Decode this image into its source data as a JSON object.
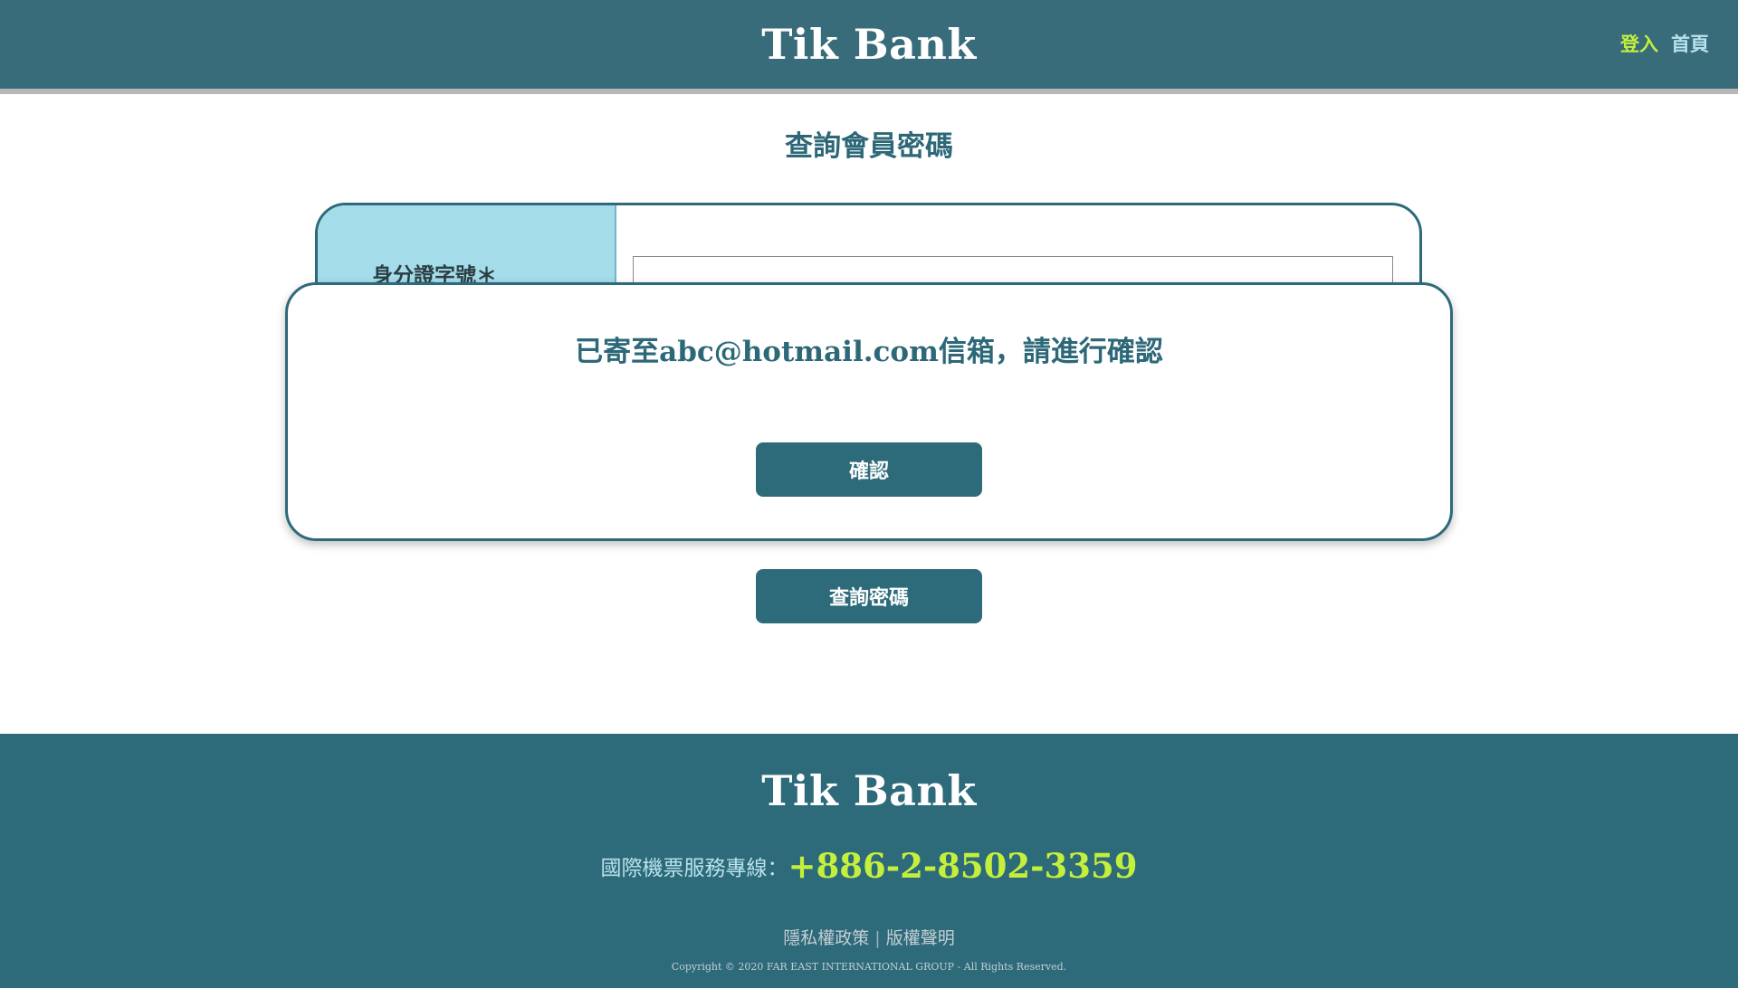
{
  "header": {
    "logo": "Tik Bank",
    "nav": {
      "login": "登入",
      "home": "首頁"
    }
  },
  "main": {
    "title": "查詢會員密碼",
    "form": {
      "id_label": "身分證字號＊",
      "id_value": ""
    },
    "query_button": "查詢密碼"
  },
  "modal": {
    "message": "已寄至abc@hotmail.com信箱，請進行確認",
    "confirm_button": "確認"
  },
  "footer": {
    "logo": "Tik Bank",
    "hotline_label": "國際機票服務專線：",
    "hotline_number": "+886-2-8502-3359",
    "links": {
      "privacy": "隱私權政策",
      "separator": "|",
      "copyright_notice": "版權聲明"
    },
    "copyright": "Copyright © 2020 FAR EAST INTERNATIONAL GROUP - All Rights Reserved."
  },
  "colors": {
    "header_bg": "#386c7b",
    "footer_bg": "#2d6a7a",
    "accent_green": "#c4ef3c",
    "label_cell_bg": "#a4dcea"
  }
}
